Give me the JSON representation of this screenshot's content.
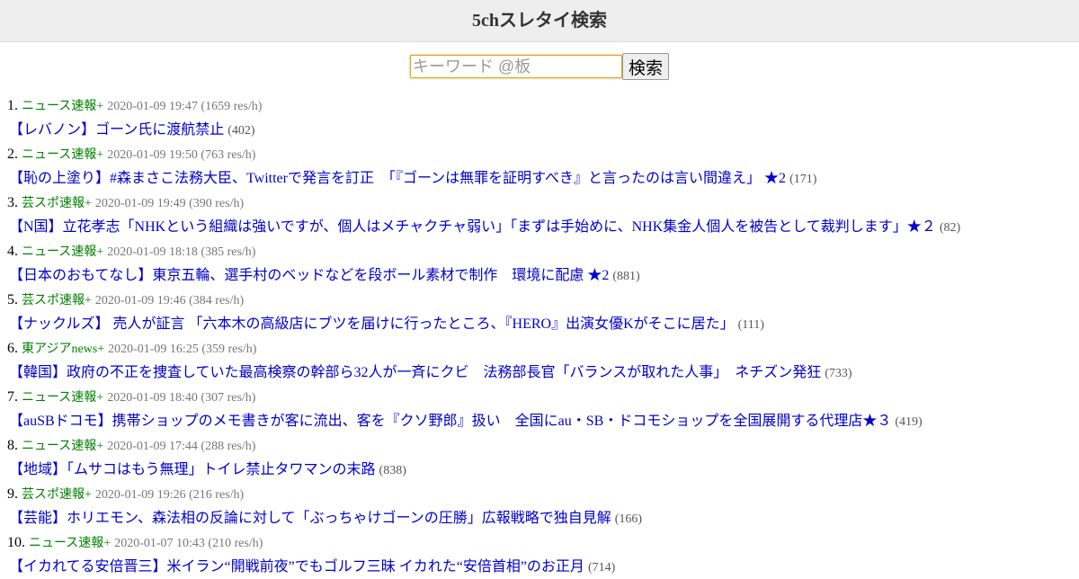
{
  "header": {
    "title": "5chスレタイ検索"
  },
  "search": {
    "placeholder": "キーワード @板",
    "button_label": "検索"
  },
  "threads": [
    {
      "num": "1.",
      "board": "ニュース速報+",
      "info": "2020-01-09 19:47 (1659 res/h)",
      "title": "【レバノン】ゴーン氏に渡航禁止",
      "count": "(402)"
    },
    {
      "num": "2.",
      "board": "ニュース速報+",
      "info": "2020-01-09 19:50 (763 res/h)",
      "title": "【恥の上塗り】#森まさこ法務大臣、Twitterで発言を訂正　「『ゴーンは無罪を証明すべき』と言ったのは言い間違え」 ★2",
      "count": "(171)"
    },
    {
      "num": "3.",
      "board": "芸スポ速報+",
      "info": "2020-01-09 19:49 (390 res/h)",
      "title": "【N国】立花孝志「NHKという組織は強いですが、個人はメチャクチャ弱い」「まずは手始めに、NHK集金人個人を被告として裁判します」★２",
      "count": "(82)"
    },
    {
      "num": "4.",
      "board": "ニュース速報+",
      "info": "2020-01-09 18:18 (385 res/h)",
      "title": "【日本のおもてなし】東京五輪、選手村のベッドなどを段ボール素材で制作　環境に配慮 ★2",
      "count": "(881)"
    },
    {
      "num": "5.",
      "board": "芸スポ速報+",
      "info": "2020-01-09 19:46 (384 res/h)",
      "title": "【ナックルズ】 売人が証言 「六本木の高級店にブツを届けに行ったところ、『HERO』出演女優Kがそこに居た」",
      "count": "(111)"
    },
    {
      "num": "6.",
      "board": "東アジアnews+",
      "info": "2020-01-09 16:25 (359 res/h)",
      "title": "【韓国】政府の不正を捜査していた最高検察の幹部ら32人が一斉にクビ　法務部長官「バランスが取れた人事」　ネチズン発狂",
      "count": "(733)"
    },
    {
      "num": "7.",
      "board": "ニュース速報+",
      "info": "2020-01-09 18:40 (307 res/h)",
      "title": "【auSBドコモ】携帯ショップのメモ書きが客に流出、客を『クソ野郎』扱い　全国にau・SB・ドコモショップを全国展開する代理店★３",
      "count": "(419)"
    },
    {
      "num": "8.",
      "board": "ニュース速報+",
      "info": "2020-01-09 17:44 (288 res/h)",
      "title": "【地域】「ムサコはもう無理」トイレ禁止タワマンの末路",
      "count": "(838)"
    },
    {
      "num": "9.",
      "board": "芸スポ速報+",
      "info": "2020-01-09 19:26 (216 res/h)",
      "title": "【芸能】ホリエモン、森法相の反論に対して「ぶっちゃけゴーンの圧勝」広報戦略で独自見解",
      "count": "(166)"
    },
    {
      "num": "10.",
      "board": "ニュース速報+",
      "info": "2020-01-07 10:43 (210 res/h)",
      "title": "【イカれてる安倍晋三】米イラン“開戦前夜”でもゴルフ三昧 イカれた“安倍首相”のお正月",
      "count": "(714)"
    }
  ]
}
